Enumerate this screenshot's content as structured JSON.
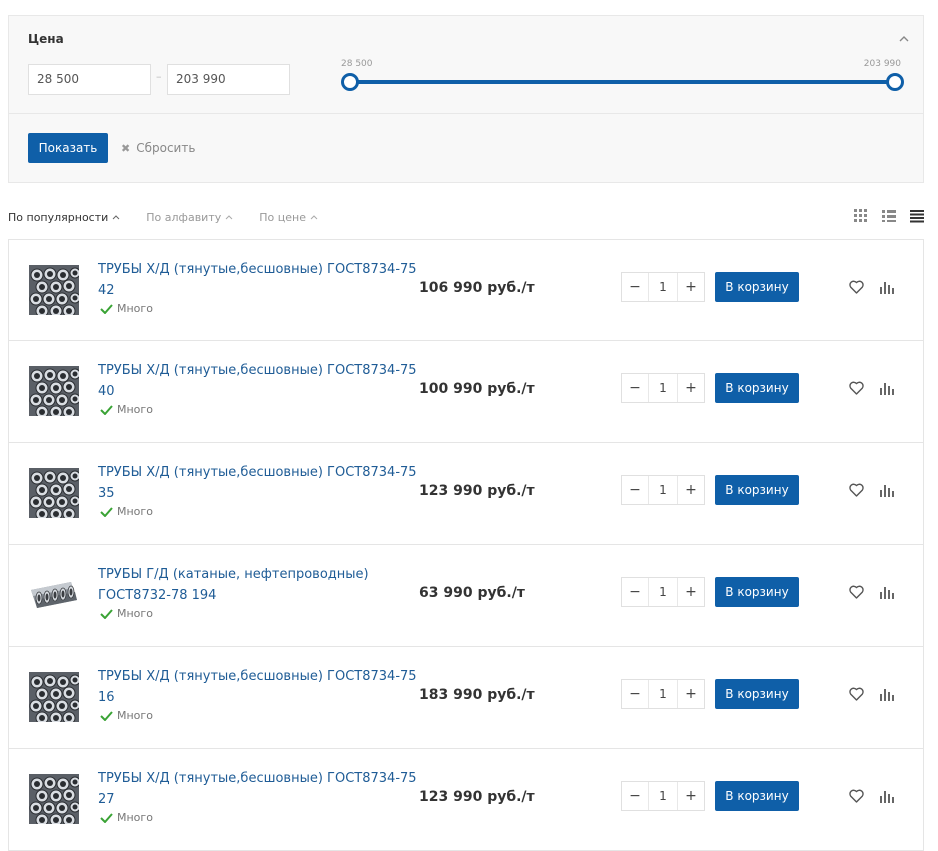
{
  "filter": {
    "title": "Цена",
    "from_value": "28 500",
    "to_value": "203 990",
    "range_min_label": "28 500",
    "range_max_label": "203 990",
    "show_label": "Показать",
    "reset_label": "Сбросить",
    "accent": "#0f5fa8"
  },
  "sort": {
    "items": [
      {
        "label": "По популярности",
        "active": true
      },
      {
        "label": "По алфавиту",
        "active": false
      },
      {
        "label": "По цене",
        "active": false
      }
    ],
    "views": [
      "grid-view-icon",
      "list-view-icon",
      "table-view-icon"
    ]
  },
  "products": [
    {
      "name": "ТРУБЫ Х/Д (тянутые,бесшовные) ГОСТ8734-75 42",
      "stock": "Много",
      "price": "106 990 руб./т",
      "qty": "1",
      "cart_label": "В корзину",
      "image": "steel-pipes-bundle"
    },
    {
      "name": "ТРУБЫ Х/Д (тянутые,бесшовные) ГОСТ8734-75 40",
      "stock": "Много",
      "price": "100 990 руб./т",
      "qty": "1",
      "cart_label": "В корзину",
      "image": "steel-pipes-bundle"
    },
    {
      "name": "ТРУБЫ Х/Д (тянутые,бесшовные) ГОСТ8734-75 35",
      "stock": "Много",
      "price": "123 990 руб./т",
      "qty": "1",
      "cart_label": "В корзину",
      "image": "steel-pipes-bundle"
    },
    {
      "name": "ТРУБЫ Г/Д (катаные, нефтепроводные) ГОСТ8732-78 194",
      "stock": "Много",
      "price": "63 990 руб./т",
      "qty": "1",
      "cart_label": "В корзину",
      "image": "steel-pipes-row"
    },
    {
      "name": "ТРУБЫ Х/Д (тянутые,бесшовные) ГОСТ8734-75 16",
      "stock": "Много",
      "price": "183 990 руб./т",
      "qty": "1",
      "cart_label": "В корзину",
      "image": "steel-pipes-bundle"
    },
    {
      "name": "ТРУБЫ Х/Д (тянутые,бесшовные) ГОСТ8734-75 27",
      "stock": "Много",
      "price": "123 990 руб./т",
      "qty": "1",
      "cart_label": "В корзину",
      "image": "steel-pipes-bundle"
    }
  ]
}
